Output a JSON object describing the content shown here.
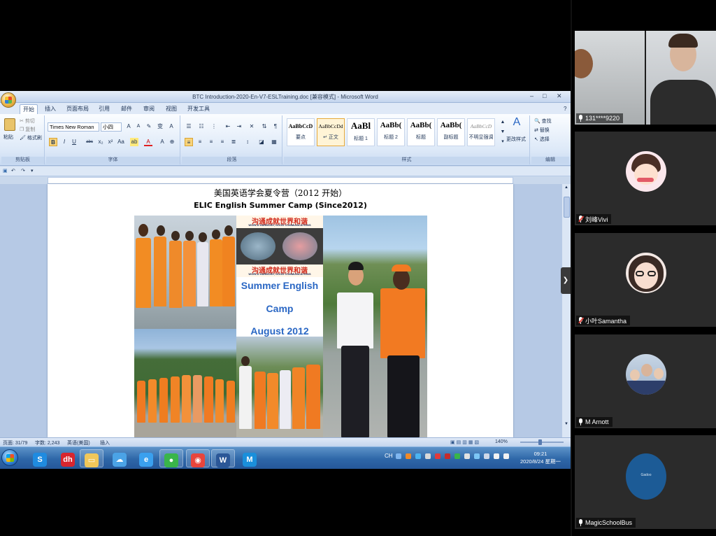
{
  "word": {
    "window_title": "BTC Introduction-2020-En-V7-ESLTraining.doc [兼容模式] - Microsoft Word",
    "window_controls": [
      "–",
      "□",
      "✕"
    ],
    "tabs": [
      "开始",
      "插入",
      "页面布局",
      "引用",
      "邮件",
      "审阅",
      "视图",
      "开发工具"
    ],
    "active_tab": "开始",
    "clipboard": {
      "paste": "粘贴",
      "cut": "剪切",
      "copy": "复制",
      "format_painter": "格式刷",
      "group": "剪贴板"
    },
    "font": {
      "name": "Times New Roman",
      "size": "小四",
      "group": "字体",
      "buttons": [
        "B",
        "I",
        "U",
        "abc",
        "x₂",
        "x²",
        "Aa",
        "A"
      ]
    },
    "paragraph": {
      "group": "段落"
    },
    "styles": {
      "group": "样式",
      "items": [
        {
          "sample": "AaBbCcD",
          "name": "要点"
        },
        {
          "sample": "AaBbCcDd",
          "name": "↵ 正文"
        },
        {
          "sample": "AaBl",
          "name": "标题 1"
        },
        {
          "sample": "AaBb(",
          "name": "标题 2"
        },
        {
          "sample": "AaBb(",
          "name": "标题"
        },
        {
          "sample": "AaBb(",
          "name": "副标题"
        },
        {
          "sample": "AaBbCcD",
          "name": "不明显强调"
        }
      ],
      "change_styles": "更改样式"
    },
    "editing": {
      "find": "查找",
      "replace": "替换",
      "select": "选择",
      "group": "编辑"
    },
    "document": {
      "title_cn": "美国英语学会夏令营（2012 开始）",
      "title_en": "ELIC English Summer Camp (Since2012)",
      "banner_cn": "沟通成就世界和谐",
      "banner_sub": "WORLD HARMONY, GOOD COMMUNICATIONS",
      "camp_line1": "Summer English",
      "camp_line2": "Camp",
      "camp_line3": "August 2012"
    },
    "statusbar": {
      "page": "页面: 31/79",
      "words": "字数: 2,243",
      "language": "英语(美国)",
      "mode": "插入",
      "zoom": "140%"
    }
  },
  "taskbar": {
    "apps": [
      {
        "icon": "sogou-icon",
        "glyph": "S",
        "color": "#1f8be0"
      },
      {
        "icon": "zhihu-icon",
        "glyph": "chip",
        "color": "#d8262f"
      },
      {
        "icon": "folder-icon",
        "glyph": "▭",
        "color": "#f1c75a"
      },
      {
        "icon": "cloud-icon",
        "glyph": "☁",
        "color": "#4ba3e6"
      },
      {
        "icon": "ie-icon",
        "glyph": "e",
        "color": "#3aa0ee"
      },
      {
        "icon": "wechat-icon",
        "glyph": "●",
        "color": "#39b54a"
      },
      {
        "icon": "chrome-icon",
        "glyph": "◉",
        "color": "#e8453c"
      },
      {
        "icon": "word-icon",
        "glyph": "W",
        "color": "#2b5797"
      },
      {
        "icon": "meeting-icon",
        "glyph": "M",
        "color": "#1a8fdb"
      }
    ],
    "tray": {
      "ime": "CH",
      "time": "09:21",
      "date": "2020/8/24 星期一"
    }
  },
  "participants": [
    {
      "name": "131****9220",
      "muted": false
    },
    {
      "name": "刘峰Vivi",
      "muted": true
    },
    {
      "name": "小叶Samantha",
      "muted": true
    },
    {
      "name": "M Arnott",
      "muted": false
    },
    {
      "name": "MagicSchoolBus",
      "muted": false,
      "avatar_text": "Gadoo"
    }
  ]
}
